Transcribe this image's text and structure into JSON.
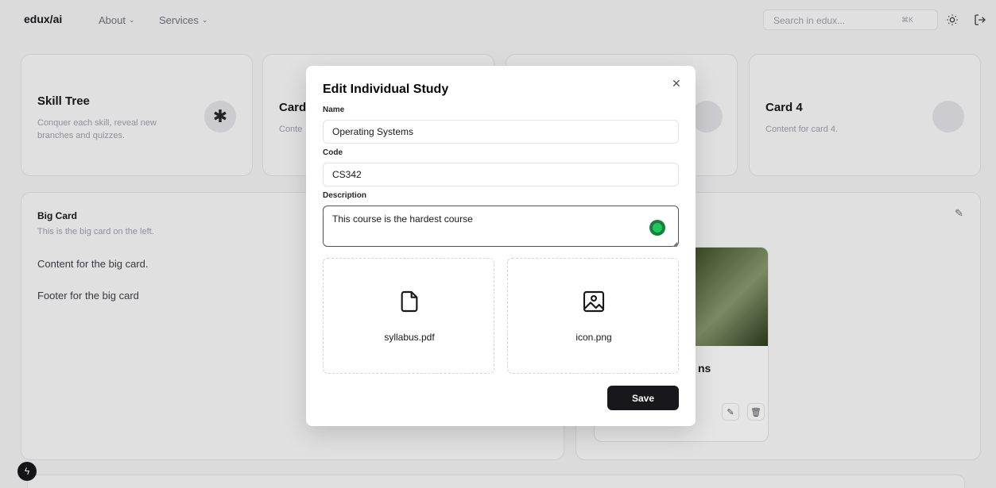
{
  "topbar": {
    "logo": "edux/ai",
    "nav": [
      "About",
      "Services"
    ],
    "search_placeholder": "Search in edux...",
    "search_shortcut": "⌘K"
  },
  "cards": {
    "skill_tree": {
      "title": "Skill Tree",
      "subtitle": "Conquer each skill, reveal new branches and quizzes."
    },
    "card2": {
      "title": "Card",
      "subtitle": "Conte"
    },
    "card4": {
      "title": "Card 4",
      "subtitle": "Content for card 4."
    }
  },
  "big_card": {
    "title": "Big Card",
    "subtitle": "This is the big card on the left.",
    "content": "Content for the big card.",
    "footer": "Footer for the big card"
  },
  "right_card": {
    "inner_title": "ns"
  },
  "modal": {
    "title": "Edit Individual Study",
    "name_label": "Name",
    "name_value": "Operating Systems",
    "code_label": "Code",
    "code_value": "CS342",
    "description_label": "Description",
    "description_value": "This course is the hardest course",
    "files": [
      {
        "name": "syllabus.pdf",
        "icon": "file-icon"
      },
      {
        "name": "icon.png",
        "icon": "image-icon"
      }
    ],
    "save_label": "Save"
  }
}
